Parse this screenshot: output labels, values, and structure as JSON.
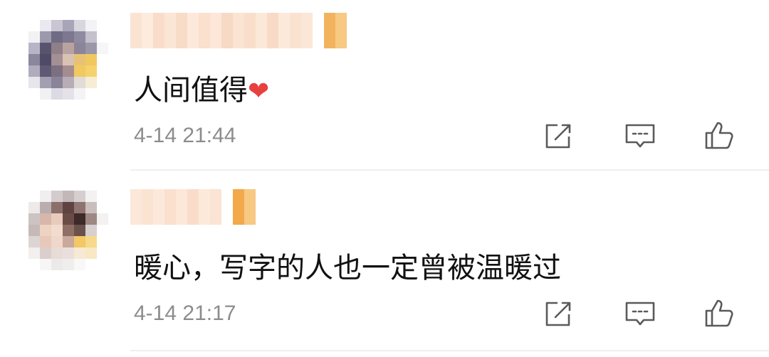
{
  "comments": [
    {
      "text": "人间值得",
      "emoji": "❤",
      "time": "4-14 21:44",
      "avatar_colors": [
        "#fff",
        "#e9e9ef",
        "#c9c6d2",
        "#a9a5b8",
        "#d8d6de",
        "#f3f3f5",
        "#fff",
        "#f2f2f4",
        "#9d99ad",
        "#6f6b84",
        "#7d7890",
        "#8e8aa0",
        "#c4c0cc",
        "#fff",
        "#b8b4c6",
        "#585470",
        "#8f7f88",
        "#b9a3a0",
        "#8c8597",
        "#9b97a8",
        "#f6f5f7",
        "#8a869c",
        "#4f4a66",
        "#a48f94",
        "#d8c2b3",
        "#e8c274",
        "#f0c85f",
        "#ffffff",
        "#b0acbd",
        "#5e5a73",
        "#7d6f82",
        "#a58c90",
        "#f0ca60",
        "#f6d26e",
        "#fff",
        "#e7e6ec",
        "#a39fb3",
        "#8a8499",
        "#b7adb6",
        "#e2dcd8",
        "#f7ecd5",
        "#fff",
        "#fff",
        "#f1f0f3",
        "#dcdae2",
        "#e4e2e8",
        "#f4f3f6",
        "#ffffff",
        "#fff"
      ],
      "name_colors": [
        "#fbe3d2",
        "#fdebdd",
        "#f9ddca",
        "#fbe5d5",
        "#f8dcc7",
        "#fde9db",
        "#fae0cd",
        "#fce7d8",
        "#f7d9c4",
        "#fbe4d3",
        "#f9dfcb",
        "#fce8d9",
        "#f8dbc6",
        "#fde9da",
        "#fae2d0",
        "#fce6d6",
        "#ffffff",
        "#f3b35e",
        "#f7c983"
      ]
    },
    {
      "text": "暖心，写字的人也一定曾被温暖过",
      "time": "4-14 21:17",
      "avatar_colors": [
        "#fff",
        "#f0eeee",
        "#d4cccc",
        "#c2b8b8",
        "#d6cfcf",
        "#f3f1f1",
        "#fff",
        "#eeeaea",
        "#b9adad",
        "#8a6f6b",
        "#5e4340",
        "#8e7470",
        "#c9bebe",
        "#fff",
        "#cdc3c3",
        "#d6b7a9",
        "#e8cbbb",
        "#6b4b45",
        "#3e2a28",
        "#9e8884",
        "#f3f1f1",
        "#c6b9b6",
        "#eed2c2",
        "#f2dccf",
        "#8f6e66",
        "#6b514c",
        "#d7d0cf",
        "#fff",
        "#ddd5d3",
        "#e8c9b9",
        "#efd7c9",
        "#c9a99b",
        "#f3c865",
        "#f6d98a",
        "#fff",
        "#f2efef",
        "#dacfcd",
        "#e8dcd7",
        "#e9e0dd",
        "#f6ead4",
        "#f8e8c3",
        "#fff",
        "#fff",
        "#f7f6f6",
        "#ece9e9",
        "#f0eded",
        "#f9f8f8",
        "#fff",
        "#fff"
      ],
      "name_colors": [
        "#fce8d9",
        "#fbe3d2",
        "#fde9dc",
        "#fae0cd",
        "#fce7d8",
        "#f9ddca",
        "#fde9da",
        "#fbe4d3",
        "#ffffff",
        "#f2a94c",
        "#f7c983"
      ]
    }
  ],
  "icons": {
    "share": "share-icon",
    "reply": "comment-icon",
    "like": "thumbs-up-icon"
  }
}
